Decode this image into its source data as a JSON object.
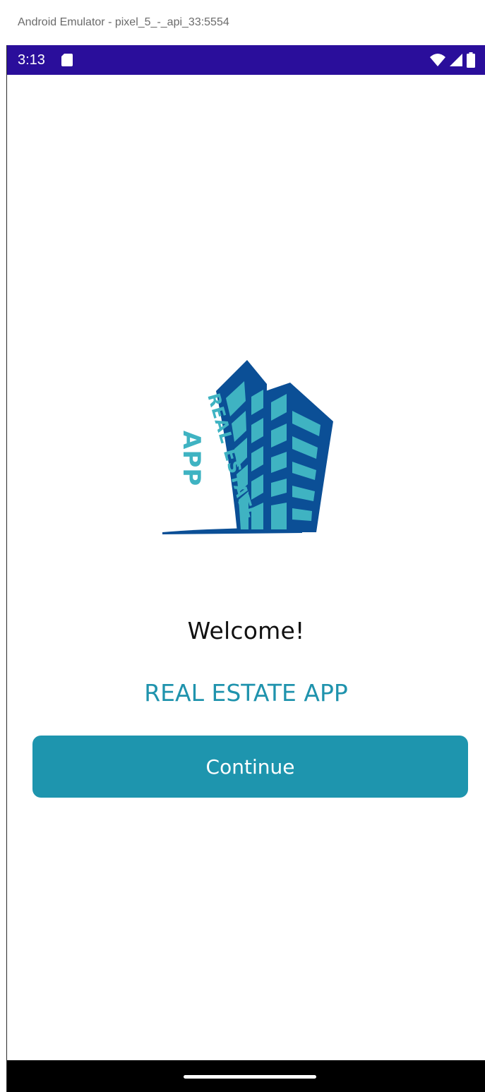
{
  "window": {
    "title": "Android Emulator - pixel_5_-_api_33:5554"
  },
  "statusbar": {
    "time": "3:13",
    "background": "#2a0e9b",
    "icons": [
      "sd-card-icon",
      "wifi-icon",
      "signal-icon",
      "battery-icon"
    ]
  },
  "logo": {
    "text_line1": "REAL ESTATE",
    "text_line2": "APP",
    "colors": {
      "dark_blue": "#0b4f96",
      "teal": "#3fb3c2"
    }
  },
  "main": {
    "welcome": "Welcome!",
    "app_name": "REAL ESTATE APP",
    "continue_label": "Continue"
  },
  "theme": {
    "accent": "#1e95ae"
  }
}
